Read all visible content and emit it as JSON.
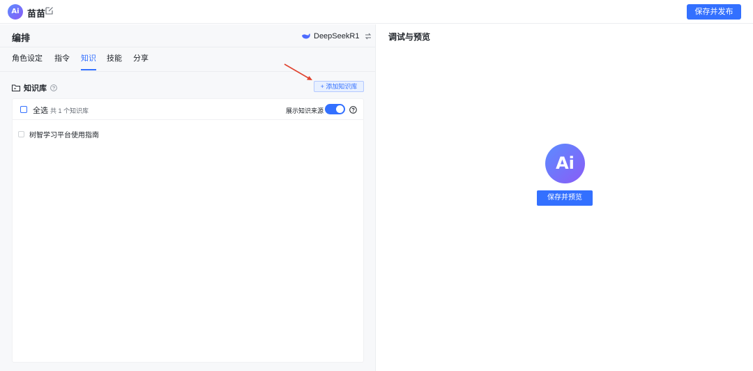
{
  "header": {
    "logo_text": "Ai",
    "app_name": "苗苗",
    "publish_label": "保存并发布"
  },
  "left": {
    "title": "编排",
    "model_name": "DeepSeekR1",
    "tabs": [
      {
        "label": "角色设定",
        "active": false
      },
      {
        "label": "指令",
        "active": false
      },
      {
        "label": "知识",
        "active": true
      },
      {
        "label": "技能",
        "active": false
      },
      {
        "label": "分享",
        "active": false
      }
    ],
    "knowledge": {
      "title": "知识库",
      "add_label": "+ 添加知识库",
      "select_all_label": "全选",
      "count_text": "共 1 个知识库",
      "show_source_label": "展示知识来源",
      "show_source_enabled": true,
      "items": [
        {
          "label": "树智学习平台使用指南",
          "checked": false
        }
      ]
    }
  },
  "right": {
    "title": "调试与预览",
    "logo_text": "Ai",
    "save_preview_label": "保存并预览"
  },
  "colors": {
    "accent": "#3370ff",
    "annotation_arrow": "#e0432f"
  }
}
